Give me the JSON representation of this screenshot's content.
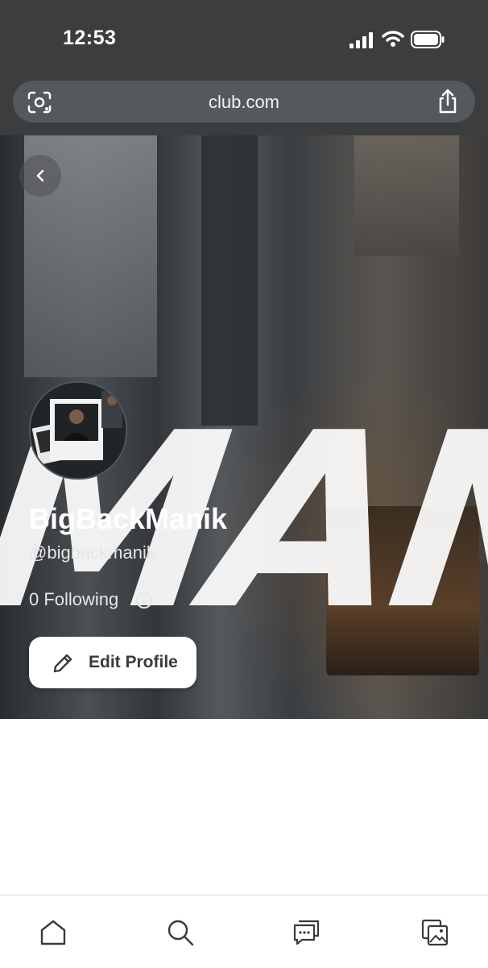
{
  "status_bar": {
    "time": "12:53"
  },
  "browser": {
    "url": "club.com"
  },
  "profile": {
    "display_name": "BigBackManik",
    "handle": "@bigbackmanik",
    "following": "0 Following",
    "edit_label": "Edit Profile",
    "banner_text": "MAN"
  },
  "bottom_nav": {
    "items": [
      "home-icon",
      "search-icon",
      "messages-icon",
      "gallery-icon"
    ]
  },
  "colors": {
    "chrome": "#3b3d3f",
    "url_bar": "#56595b",
    "white": "#ffffff"
  }
}
